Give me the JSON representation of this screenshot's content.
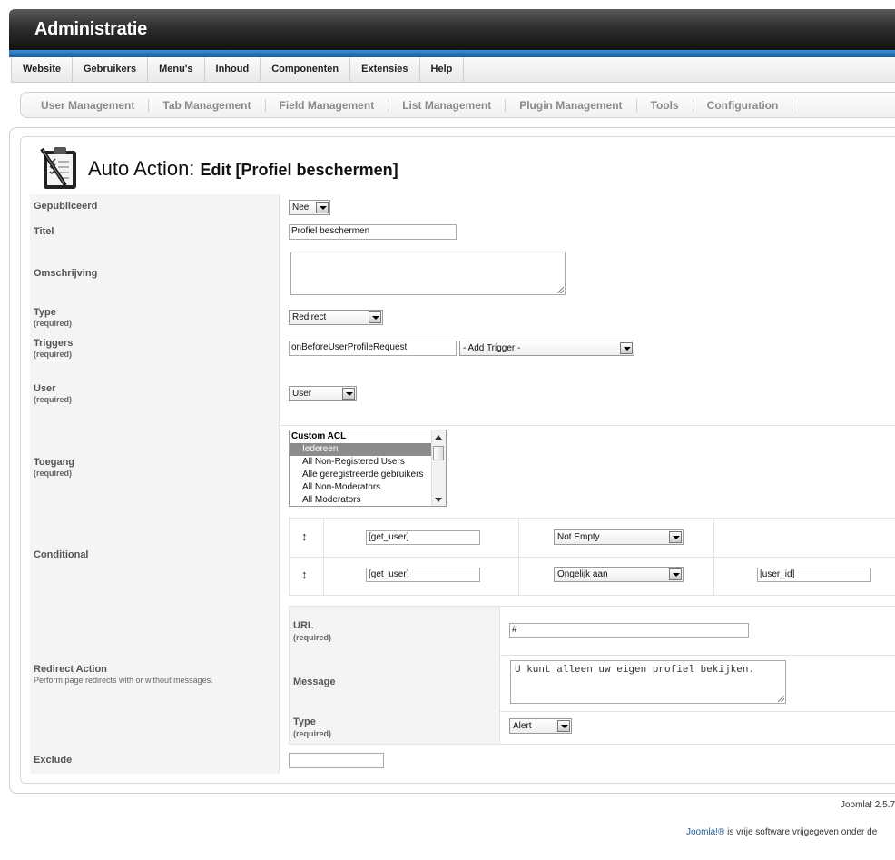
{
  "header": {
    "title": "Administratie"
  },
  "menu": [
    "Website",
    "Gebruikers",
    "Menu's",
    "Inhoud",
    "Componenten",
    "Extensies",
    "Help"
  ],
  "submenu": [
    "User Management",
    "Tab Management",
    "Field Management",
    "List Management",
    "Plugin Management",
    "Tools",
    "Configuration"
  ],
  "page": {
    "title": "Auto Action:",
    "subtitle": "Edit [Profiel beschermen]"
  },
  "required_label": "(required)",
  "form": {
    "published": {
      "label": "Gepubliceerd",
      "value": "Nee"
    },
    "title": {
      "label": "Titel",
      "value": "Profiel beschermen"
    },
    "description": {
      "label": "Omschrijving",
      "value": ""
    },
    "type": {
      "label": "Type",
      "value": "Redirect"
    },
    "triggers": {
      "label": "Triggers",
      "value": "onBeforeUserProfileRequest",
      "add_placeholder": "- Add Trigger -"
    },
    "user": {
      "label": "User",
      "value": "User"
    },
    "access": {
      "label": "Toegang",
      "group": "Custom ACL",
      "options": [
        "Iedereen",
        "All Non-Registered Users",
        "Alle geregistreerde gebruikers",
        "All Non-Moderators",
        "All Moderators"
      ],
      "selected": "Iedereen"
    },
    "conditional": {
      "label": "Conditional",
      "rows": [
        {
          "field": "[get_user]",
          "operator": "Not Empty",
          "value": ""
        },
        {
          "field": "[get_user]",
          "operator": "Ongelijk aan",
          "value": "[user_id]"
        }
      ]
    },
    "redirect_action": {
      "label": "Redirect Action",
      "description": "Perform page redirects with or without messages.",
      "url": {
        "label": "URL",
        "value": "#"
      },
      "message": {
        "label": "Message",
        "value": "U kunt alleen uw eigen profiel bekijken."
      },
      "type": {
        "label": "Type",
        "value": "Alert"
      }
    },
    "exclude": {
      "label": "Exclude",
      "value": ""
    }
  },
  "footer": {
    "version": "Joomla! 2.5.7",
    "license_link": "Joomla!®",
    "license_text": " is vrije software vrijgegeven onder de"
  }
}
